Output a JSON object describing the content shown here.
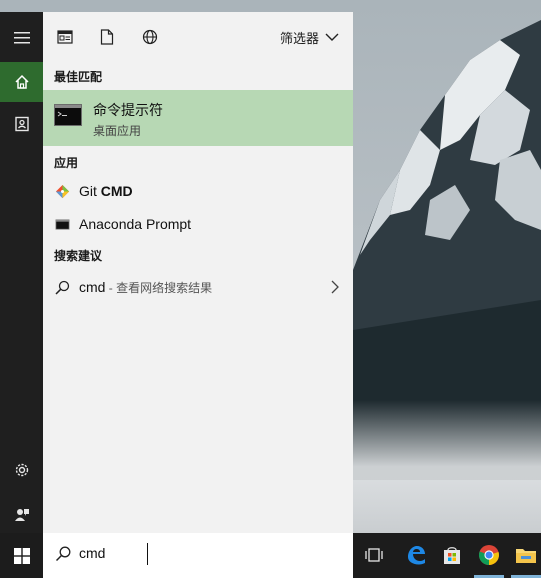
{
  "top_bar": {
    "filter_label": "筛选器",
    "icons": [
      "document-app-icon",
      "file-icon",
      "globe-icon"
    ]
  },
  "sections": {
    "best_match_header": "最佳匹配",
    "apps_header": "应用",
    "suggestions_header": "搜索建议"
  },
  "best_match": {
    "title": "命令提示符",
    "subtitle": "桌面应用",
    "icon": "cmd-console-icon"
  },
  "apps": [
    {
      "name_prefix": "Git ",
      "name_bold": "CMD",
      "icon": "git-icon"
    },
    {
      "name_prefix": "Anaconda Prompt",
      "name_bold": "",
      "icon": "console-icon"
    }
  ],
  "suggestion": {
    "query": "cmd",
    "description": " - 查看网络搜索结果"
  },
  "search": {
    "value": "cmd"
  },
  "rail": {
    "items": [
      "hamburger-icon",
      "home-icon",
      "notebook-icon",
      "settings-icon",
      "feedback-icon"
    ]
  },
  "taskbar": {
    "items": [
      "task-view-icon",
      "edge-icon",
      "store-icon",
      "chrome-icon",
      "file-explorer-icon"
    ]
  },
  "colors": {
    "accent": "#2e6b2e",
    "best_match_bg": "#b7d8b4",
    "panel_bg": "#f2f2f2",
    "rail_bg": "#1f1f1f",
    "taskbar_bg": "#1c1c1c"
  }
}
